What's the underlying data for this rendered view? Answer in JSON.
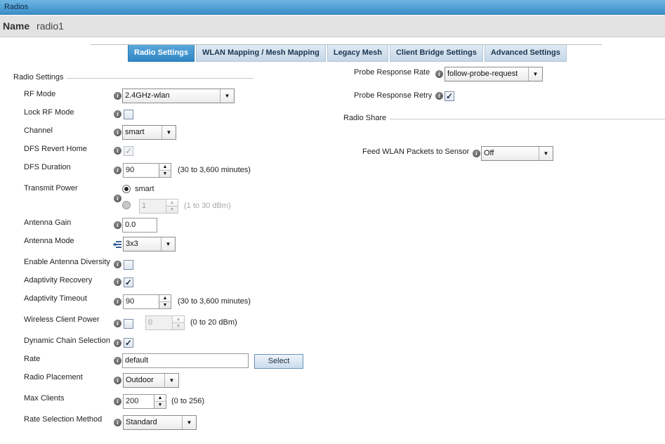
{
  "window": {
    "title": "Radios"
  },
  "name_bar": {
    "label": "Name",
    "value": "radio1"
  },
  "tabs": [
    {
      "label": "Radio Settings",
      "active": true
    },
    {
      "label": "WLAN Mapping / Mesh Mapping",
      "active": false
    },
    {
      "label": "Legacy Mesh",
      "active": false
    },
    {
      "label": "Client Bridge Settings",
      "active": false
    },
    {
      "label": "Advanced Settings",
      "active": false
    }
  ],
  "radio_settings": {
    "section_title": "Radio Settings",
    "rf_mode": {
      "label": "RF Mode",
      "value": "2.4GHz-wlan"
    },
    "lock_rf_mode": {
      "label": "Lock RF Mode",
      "checked": false
    },
    "channel": {
      "label": "Channel",
      "value": "smart"
    },
    "dfs_revert_home": {
      "label": "DFS Revert Home",
      "checked": true,
      "disabled": true
    },
    "dfs_duration": {
      "label": "DFS Duration",
      "value": "90",
      "hint": "(30 to 3,600 minutes)"
    },
    "transmit_power": {
      "label": "Transmit Power",
      "option_smart": "smart",
      "value": "1",
      "hint": "(1 to 30 dBm)"
    },
    "antenna_gain": {
      "label": "Antenna Gain",
      "value": "0.0"
    },
    "antenna_mode": {
      "label": "Antenna Mode",
      "value": "3x3"
    },
    "enable_antenna_diversity": {
      "label": "Enable Antenna Diversity",
      "checked": false
    },
    "adaptivity_recovery": {
      "label": "Adaptivity Recovery",
      "checked": true
    },
    "adaptivity_timeout": {
      "label": "Adaptivity Timeout",
      "value": "90",
      "hint": "(30 to 3,600 minutes)"
    },
    "wireless_client_power": {
      "label": "Wireless Client Power",
      "checked": false,
      "value": "0",
      "hint": "(0 to 20 dBm)"
    },
    "dynamic_chain_selection": {
      "label": "Dynamic Chain Selection",
      "checked": true
    },
    "rate": {
      "label": "Rate",
      "value": "default",
      "button": "Select"
    },
    "radio_placement": {
      "label": "Radio Placement",
      "value": "Outdoor"
    },
    "max_clients": {
      "label": "Max Clients",
      "value": "200",
      "hint": "(0 to 256)"
    },
    "rate_selection_method": {
      "label": "Rate Selection Method",
      "value": "Standard"
    }
  },
  "probe": {
    "response_rate": {
      "label": "Probe Response Rate",
      "value": "follow-probe-request"
    },
    "response_retry": {
      "label": "Probe Response Retry",
      "checked": true
    }
  },
  "radio_share": {
    "section_title": "Radio Share",
    "feed_wlan": {
      "label": "Feed WLAN Packets to Sensor",
      "value": "Off"
    }
  },
  "icons": {
    "info": "info-icon",
    "dropdown": "chevron-down-icon",
    "mode": "antenna-mode-icon",
    "check": "check-icon"
  },
  "colors": {
    "title_bar": "#3b8fc9",
    "active_tab": "#2f86c4",
    "inactive_tab": "#c6d7e6"
  }
}
